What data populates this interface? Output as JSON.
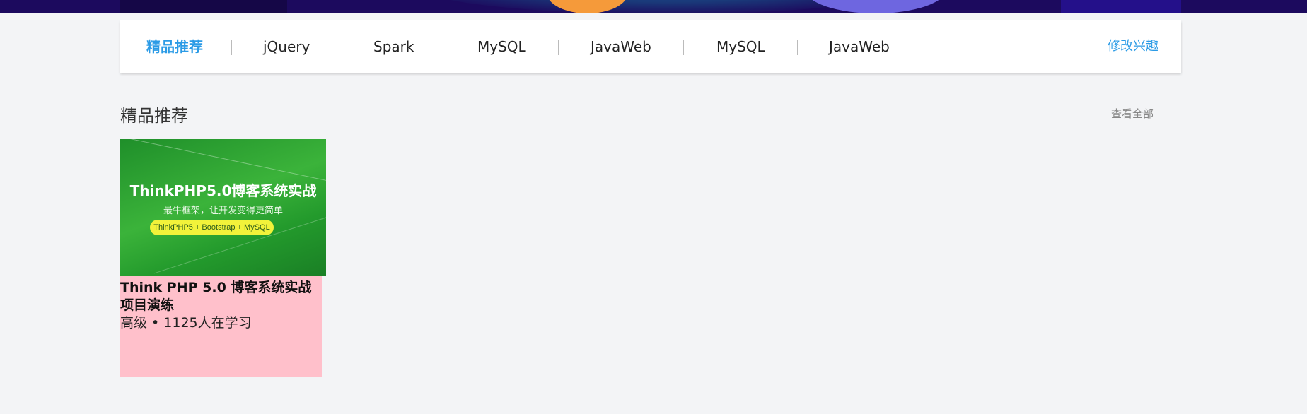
{
  "nav": {
    "items": [
      {
        "label": "精品推荐",
        "active": true
      },
      {
        "label": "jQuery",
        "active": false
      },
      {
        "label": "Spark",
        "active": false
      },
      {
        "label": "MySQL",
        "active": false
      },
      {
        "label": "JavaWeb",
        "active": false
      },
      {
        "label": "MySQL",
        "active": false
      },
      {
        "label": "JavaWeb",
        "active": false
      }
    ],
    "edit_interests": "修改兴趣"
  },
  "section": {
    "title": "精品推荐",
    "view_all": "查看全部"
  },
  "course": {
    "thumb_title": "ThinkPHP5.0博客系统实战",
    "thumb_subtitle": "最牛框架，让开发变得更简单",
    "thumb_tag": "ThinkPHP5 + Bootstrap + MySQL",
    "title": "Think PHP 5.0 博客系统实战项目演练",
    "meta": "高级 • 1125人在学习"
  },
  "colors": {
    "accent": "#2b9be6",
    "card_body": "#ffc0cb",
    "page_bg": "#f3f4f6"
  }
}
